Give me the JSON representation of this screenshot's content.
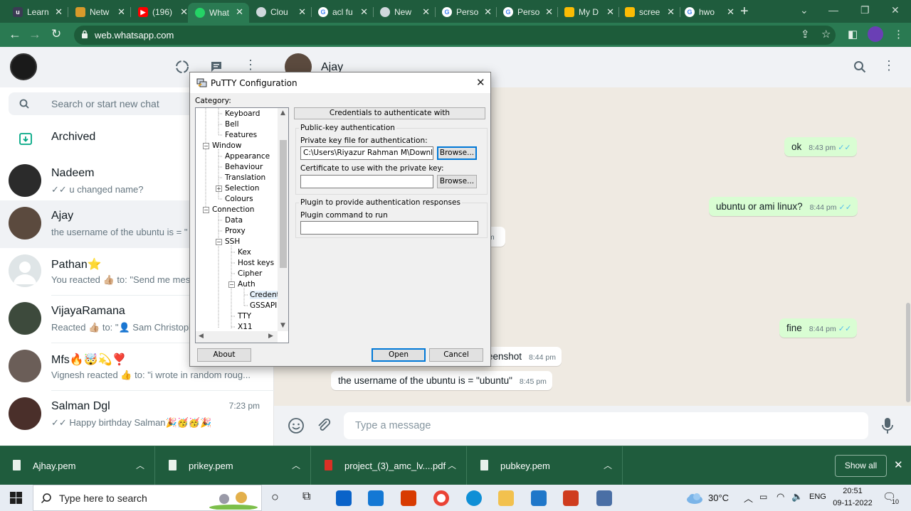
{
  "browser": {
    "tabs": [
      {
        "label": "Learn",
        "icon": "udemy-icon",
        "color": "#a435f0"
      },
      {
        "label": "Netw",
        "icon": "package-icon",
        "color": "#d89a2b"
      },
      {
        "label": "(196)",
        "icon": "youtube-icon",
        "color": "#ff0000"
      },
      {
        "label": "What",
        "icon": "whatsapp-icon",
        "color": "#25d366",
        "active": true
      },
      {
        "label": "Clou",
        "icon": "cloud-icon",
        "color": "#cfd8dc"
      },
      {
        "label": "acl fu",
        "icon": "google-icon",
        "color": "#ffffff"
      },
      {
        "label": "New",
        "icon": "chrome-icon",
        "color": "#cfd8dc"
      },
      {
        "label": "Perso",
        "icon": "google-icon",
        "color": "#ffffff"
      },
      {
        "label": "Perso",
        "icon": "google-icon",
        "color": "#ffffff"
      },
      {
        "label": "My D",
        "icon": "drive-icon",
        "color": "#fbbc04"
      },
      {
        "label": "scree",
        "icon": "drive-icon",
        "color": "#fbbc04"
      },
      {
        "label": "hwo",
        "icon": "google-icon",
        "color": "#ffffff"
      }
    ],
    "url": "web.whatsapp.com"
  },
  "whatsapp": {
    "search_placeholder": "Search or start new chat",
    "archived_label": "Archived",
    "chats": [
      {
        "name": "Nadeem",
        "preview": "✓✓ u changed name?",
        "time": ""
      },
      {
        "name": "Ajay",
        "preview": "the username of the ubuntu is = \"",
        "time": "",
        "selected": true
      },
      {
        "name": "Pathan⭐",
        "preview": "You reacted 👍🏼 to: \"Send me mes",
        "time": ""
      },
      {
        "name": "VijayaRamana",
        "preview": "Reacted 👍🏼 to: \"👤 Sam Christoph",
        "time": ""
      },
      {
        "name": "Mfs🔥🤯💫❣️",
        "preview": "Vignesh reacted 👍 to: \"i wrote in random roug...",
        "time": ""
      },
      {
        "name": "Salman Dgl",
        "preview": "✓✓ Happy birthday Salman🎉🥳🥳🎉",
        "time": "7:23 pm"
      }
    ],
    "conversation": {
      "contact_name": "Ajay",
      "messages": [
        {
          "text": "ok",
          "time": "8:43 pm",
          "ticks": "✓✓"
        },
        {
          "text": "ubuntu or ami linux?",
          "time": "8:44 pm",
          "ticks": "✓✓"
        },
        {
          "text": "",
          "time": "pm"
        },
        {
          "text": "fine",
          "time": "8:44 pm",
          "ticks": "✓✓"
        },
        {
          "text": "eenshot",
          "time": "8:44 pm"
        },
        {
          "text": "the username of the ubuntu is = \"ubuntu\"",
          "time": "8:45 pm"
        }
      ],
      "input_placeholder": "Type a message"
    }
  },
  "putty": {
    "title": "PuTTY Configuration",
    "category_label": "Category:",
    "tree": [
      "Keyboard",
      "Bell",
      "Features",
      "Window",
      "Appearance",
      "Behaviour",
      "Translation",
      "Selection",
      "Colours",
      "Connection",
      "Data",
      "Proxy",
      "SSH",
      "Kex",
      "Host keys",
      "Cipher",
      "Auth",
      "Credenti",
      "GSSAPI",
      "TTY",
      "X11"
    ],
    "panel_header": "Credentials to authenticate with",
    "group1_title": "Public-key authentication",
    "private_key_label": "Private key file for authentication:",
    "private_key_value": "C:\\Users\\Riyazur Rahman M\\Downloads",
    "browse_label": "Browse...",
    "cert_label": "Certificate to use with the private key:",
    "cert_value": "",
    "group2_title": "Plugin to provide authentication responses",
    "plugin_label": "Plugin command to run",
    "plugin_value": "",
    "about_label": "About",
    "open_label": "Open",
    "cancel_label": "Cancel"
  },
  "downloads": {
    "items": [
      {
        "name": "Ajhay.pem",
        "type": "file"
      },
      {
        "name": "prikey.pem",
        "type": "file"
      },
      {
        "name": "project_(3)_amc_lv....pdf",
        "type": "pdf"
      },
      {
        "name": "pubkey.pem",
        "type": "file"
      }
    ],
    "show_all": "Show all"
  },
  "taskbar": {
    "search_placeholder": "Type here to search",
    "temperature": "30°C",
    "language": "ENG",
    "time": "20:51",
    "date": "09-11-2022",
    "notification_count": "10"
  }
}
